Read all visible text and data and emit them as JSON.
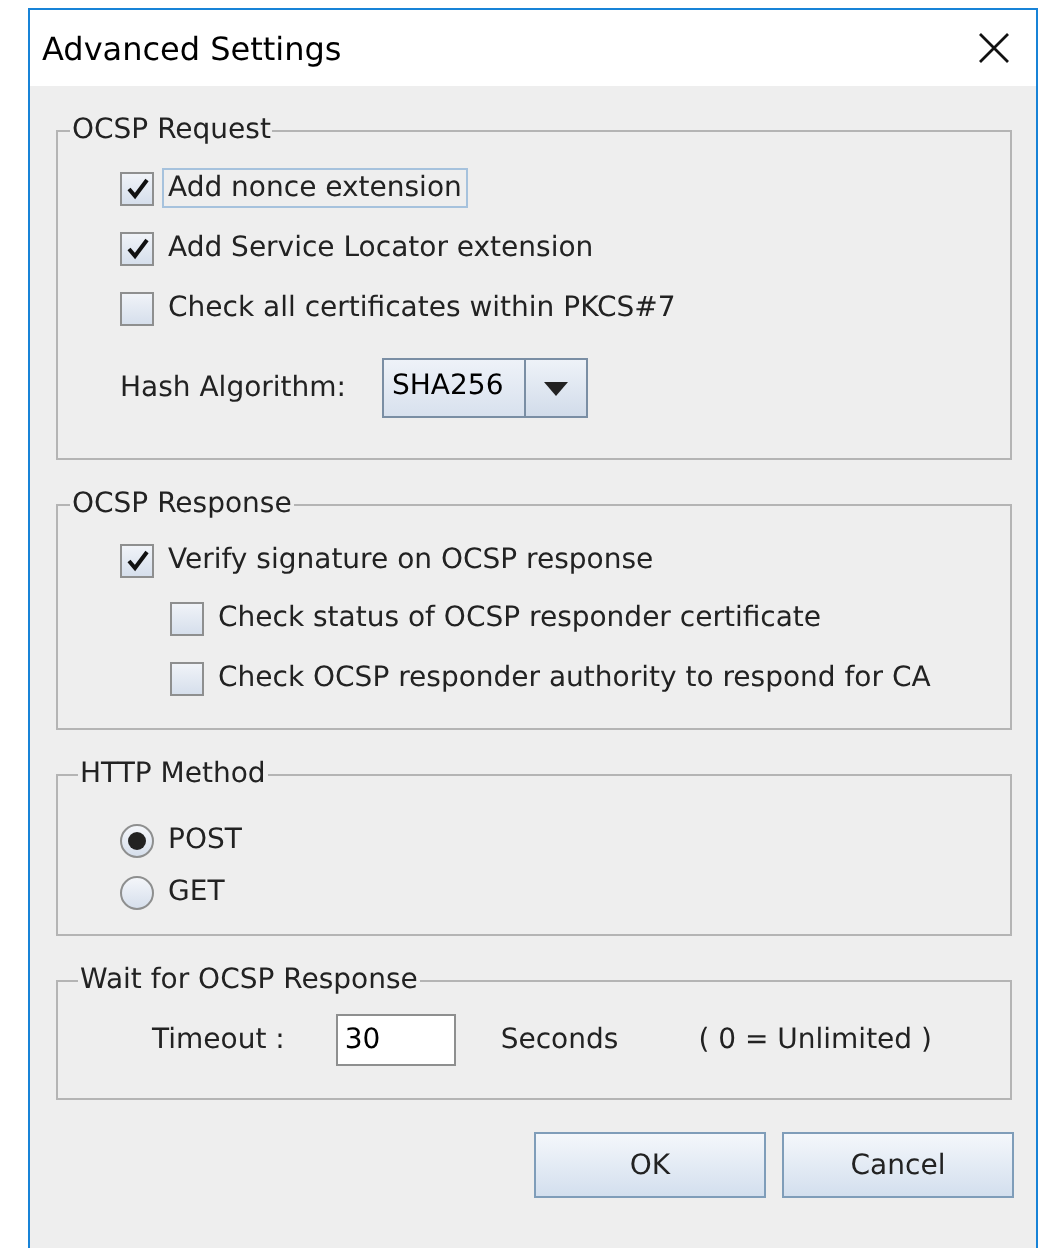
{
  "window": {
    "title": "Advanced Settings"
  },
  "ocsp_request": {
    "title": "OCSP Request",
    "options": [
      {
        "label": "Add nonce extension",
        "checked": true,
        "focused": true
      },
      {
        "label": "Add Service Locator extension",
        "checked": true,
        "focused": false
      },
      {
        "label": "Check all certificates within PKCS#7",
        "checked": false,
        "focused": false
      }
    ],
    "hash_algorithm": {
      "label": "Hash Algorithm:",
      "value": "SHA256"
    }
  },
  "ocsp_response": {
    "title": "OCSP Response",
    "options": [
      {
        "label": "Verify signature on OCSP response",
        "checked": true,
        "children": [
          {
            "label": "Check status of OCSP responder certificate",
            "checked": false
          },
          {
            "label": "Check OCSP responder authority to respond for CA",
            "checked": false
          }
        ]
      }
    ]
  },
  "http_method": {
    "title": "HTTP Method",
    "options": [
      {
        "label": "POST",
        "selected": true
      },
      {
        "label": "GET",
        "selected": false
      }
    ]
  },
  "wait_for_response": {
    "title": "Wait for OCSP Response",
    "timeout_label": "Timeout :",
    "value": "30",
    "unit": "Seconds",
    "hint": "( 0 = Unlimited )"
  },
  "buttons": [
    {
      "label": "OK"
    },
    {
      "label": "Cancel"
    }
  ]
}
